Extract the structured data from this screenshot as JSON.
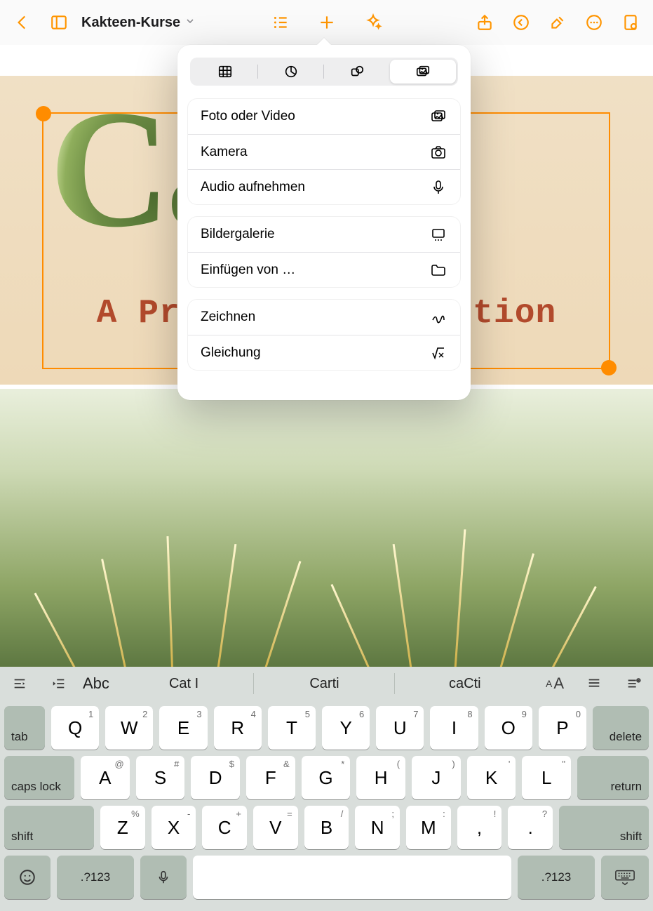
{
  "doc": {
    "title": "Kakteen-Kurse"
  },
  "slide": {
    "title": "Cacti",
    "subtitle": "A Prickly Introduction"
  },
  "popover": {
    "segments": [
      "table",
      "chart",
      "shapes",
      "media"
    ],
    "active_segment": 3,
    "groups": [
      {
        "rows": [
          {
            "label": "Foto oder Video",
            "icon": "photos-icon"
          },
          {
            "label": "Kamera",
            "icon": "camera-icon"
          },
          {
            "label": "Audio aufnehmen",
            "icon": "microphone-icon"
          }
        ]
      },
      {
        "rows": [
          {
            "label": "Bildergalerie",
            "icon": "gallery-icon"
          },
          {
            "label": "Einfügen von …",
            "icon": "folder-icon"
          }
        ]
      },
      {
        "rows": [
          {
            "label": "Zeichnen",
            "icon": "scribble-icon"
          },
          {
            "label": "Gleichung",
            "icon": "equation-icon"
          }
        ]
      }
    ]
  },
  "predictions": {
    "abc": "Abc",
    "suggestions": [
      "Cat I",
      "Carti",
      "caCti"
    ]
  },
  "keyboard": {
    "row1_hints": [
      "1",
      "2",
      "3",
      "4",
      "5",
      "6",
      "7",
      "8",
      "9",
      "0"
    ],
    "row1": [
      "Q",
      "W",
      "E",
      "R",
      "T",
      "Y",
      "U",
      "I",
      "O",
      "P"
    ],
    "row2_hints": [
      "@",
      "#",
      "$",
      "&",
      "*",
      "(",
      ")",
      "'",
      "\""
    ],
    "row2": [
      "A",
      "S",
      "D",
      "F",
      "G",
      "H",
      "J",
      "K",
      "L"
    ],
    "row3_hints": [
      "%",
      "-",
      "+",
      "=",
      "/",
      ";",
      ":",
      "!",
      "?"
    ],
    "row3": [
      "Z",
      "X",
      "C",
      "V",
      "B",
      "N",
      "M",
      ",",
      "."
    ],
    "labels": {
      "tab": "tab",
      "delete": "delete",
      "caps": "caps lock",
      "return": "return",
      "shift": "shift",
      "numbers": ".?123"
    }
  }
}
